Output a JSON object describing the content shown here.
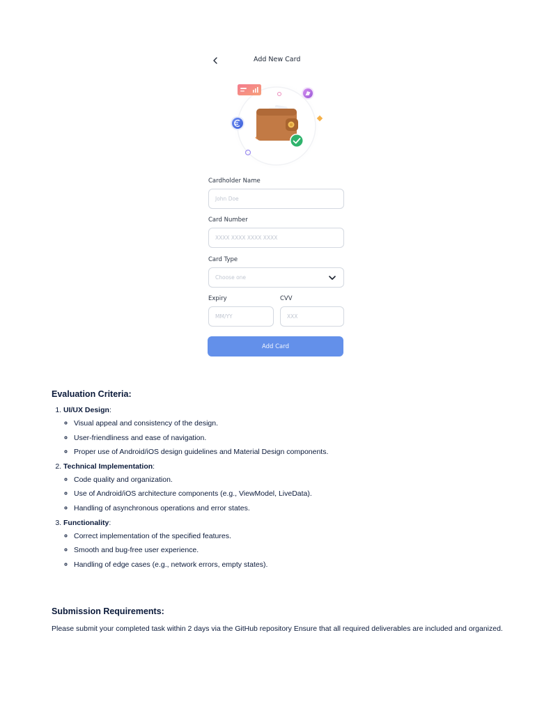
{
  "mockup": {
    "header": {
      "title": "Add New Card"
    },
    "fields": {
      "cardholder_name": {
        "label": "Cardholder Name",
        "placeholder": "John Doe"
      },
      "card_number": {
        "label": "Card Number",
        "placeholder": "XXXX XXXX XXXX XXXX"
      },
      "card_type": {
        "label": "Card Type",
        "placeholder": "Choose one"
      },
      "expiry": {
        "label": "Expiry",
        "placeholder": "MM/YY"
      },
      "cvv": {
        "label": "CVV",
        "placeholder": "XXX"
      }
    },
    "submit_label": "Add Card",
    "colors": {
      "accent": "#6390ea",
      "wallet": "#c27a45",
      "check": "#2fb36c"
    }
  },
  "evaluation": {
    "title": "Evaluation Criteria:",
    "items": [
      {
        "heading": "UI/UX Design",
        "points": [
          "Visual appeal and consistency of the design.",
          "User-friendliness and ease of navigation.",
          "Proper use of Android/iOS design guidelines and Material Design components."
        ]
      },
      {
        "heading": "Technical Implementation",
        "points": [
          "Code quality and organization.",
          "Use of Android/iOS architecture components (e.g., ViewModel, LiveData).",
          "Handling of asynchronous operations and error states."
        ]
      },
      {
        "heading": "Functionality",
        "points": [
          "Correct implementation of the specified features.",
          "Smooth and bug-free user experience.",
          "Handling of edge cases (e.g., network errors, empty states)."
        ]
      }
    ]
  },
  "submission": {
    "title": "Submission Requirements:",
    "text": "Please submit your completed task within 2 days via the GitHub repository Ensure that all required deliverables are included and organized."
  }
}
